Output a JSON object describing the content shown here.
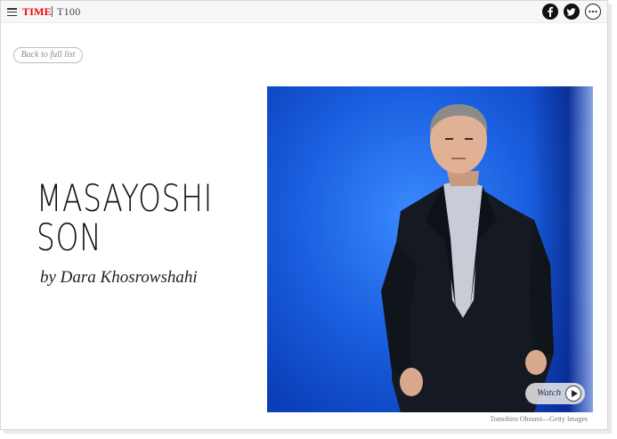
{
  "header": {
    "brand": "TIME",
    "section": "T100",
    "social": [
      "facebook-icon",
      "twitter-icon",
      "more-icon"
    ]
  },
  "nav": {
    "back_label": "Back to full list"
  },
  "profile": {
    "name_line1": "MASAYOSHI",
    "name_line2": "SON",
    "byline": "by Dara Khosrowshahi",
    "photo_credit": "Tomohiro Ohsumi—Getty Images",
    "watch_label": "Watch"
  },
  "colors": {
    "brand_red": "#e90606",
    "photo_blue": "#1a5fe0"
  }
}
